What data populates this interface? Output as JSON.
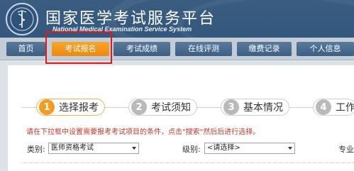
{
  "header": {
    "title": "国家医学考试服务平台",
    "subtitle": "National Medical Examination Service System",
    "logo_icon": "caduceus-seal-icon"
  },
  "nav": {
    "items": [
      {
        "label": "首页",
        "active": false
      },
      {
        "label": "考试报名",
        "active": true
      },
      {
        "label": "考试成绩",
        "active": false
      },
      {
        "label": "在线评测",
        "active": false
      },
      {
        "label": "缴费记录",
        "active": false
      },
      {
        "label": "个人信息",
        "active": false
      }
    ]
  },
  "steps": [
    {
      "number": "1",
      "label": "选择报考",
      "active": true
    },
    {
      "number": "2",
      "label": "考试须知",
      "active": false
    },
    {
      "number": "3",
      "label": "基本情况",
      "active": false
    },
    {
      "number": "4",
      "label": "工作",
      "active": false
    }
  ],
  "notice": "请在下拉框中设置需要报考考试项目的条件，点击\"搜索\"然后后进行选择。",
  "form": {
    "category_label": "类别:",
    "category_value": "医师资格考试",
    "level_label": "级别:",
    "level_value": "<请选择>",
    "major_label": "专业"
  },
  "colors": {
    "header_bg": "#34587e",
    "nav_active": "#f39c1f",
    "highlight": "#e0191b",
    "notice_text": "#c0392b"
  }
}
